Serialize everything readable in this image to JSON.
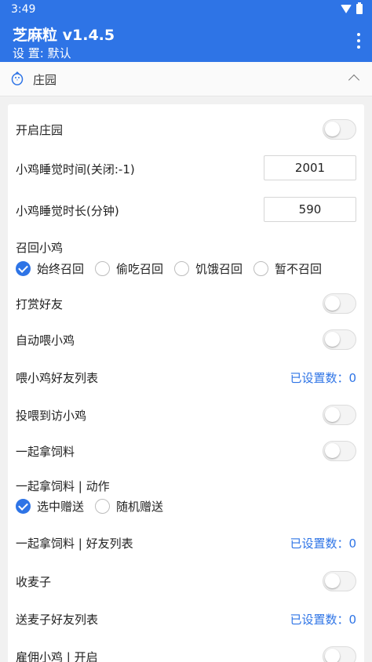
{
  "status": {
    "time": "3:49"
  },
  "app": {
    "title": "芝麻粒 v1.4.5",
    "subtitle": "设 置: 默认"
  },
  "section": {
    "title": "庄园"
  },
  "settings": {
    "enable_farm": "开启庄园",
    "sleep_time": {
      "label": "小鸡睡觉时间(关闭:-1)",
      "value": "2001"
    },
    "sleep_duration": {
      "label": "小鸡睡觉时长(分钟)",
      "value": "590"
    },
    "recall": {
      "label": "召回小鸡",
      "options": [
        "始终召回",
        "偷吃召回",
        "饥饿召回",
        "暂不召回"
      ],
      "selected": "始终召回"
    },
    "reward_friends": "打赏好友",
    "auto_feed": "自动喂小鸡",
    "feed_friend_list": {
      "label": "喂小鸡好友列表",
      "value": "已设置数：0"
    },
    "feed_visiting": "投喂到访小鸡",
    "collect_feed": "一起拿饲料",
    "collect_feed_action": {
      "label": "一起拿饲料 | 动作",
      "options": [
        "选中赠送",
        "随机赠送"
      ],
      "selected": "选中赠送"
    },
    "collect_feed_friends": {
      "label": "一起拿饲料 | 好友列表",
      "value": "已设置数：0"
    },
    "harvest_wheat": "收麦子",
    "gift_wheat_friends": {
      "label": "送麦子好友列表",
      "value": "已设置数：0"
    },
    "hire_chicken": "雇佣小鸡 | 开启"
  },
  "colors": {
    "accent": "#2e74e6",
    "background": "#f1f1f1"
  }
}
